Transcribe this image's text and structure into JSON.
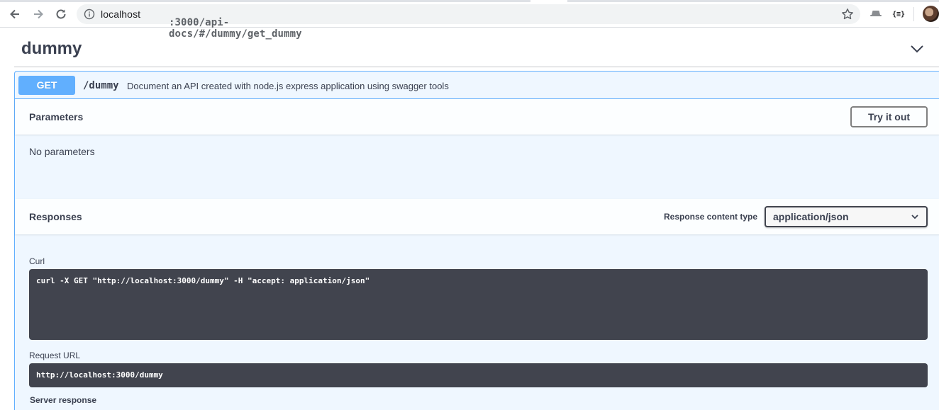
{
  "browser": {
    "url_host": "localhost",
    "url_path": ":3000/api-docs/#/dummy/get_dummy",
    "extension_json_label": "{≡}"
  },
  "tag": {
    "title": "dummy"
  },
  "operation": {
    "method": "GET",
    "path": "/dummy",
    "summary": "Document an API created with node.js express application using swagger tools",
    "parameters": {
      "title": "Parameters",
      "try_button": "Try it out",
      "empty_text": "No parameters"
    },
    "responses": {
      "title": "Responses",
      "content_type_label": "Response content type",
      "content_type_value": "application/json",
      "curl_label": "Curl",
      "curl_command": "curl -X GET \"http://localhost:3000/dummy\" -H \"accept: application/json\"",
      "request_url_label": "Request URL",
      "request_url": "http://localhost:3000/dummy",
      "server_response_label": "Server response"
    }
  },
  "colors": {
    "get_accent": "#61affe",
    "code_bg": "#41444e",
    "text": "#3b4151"
  }
}
